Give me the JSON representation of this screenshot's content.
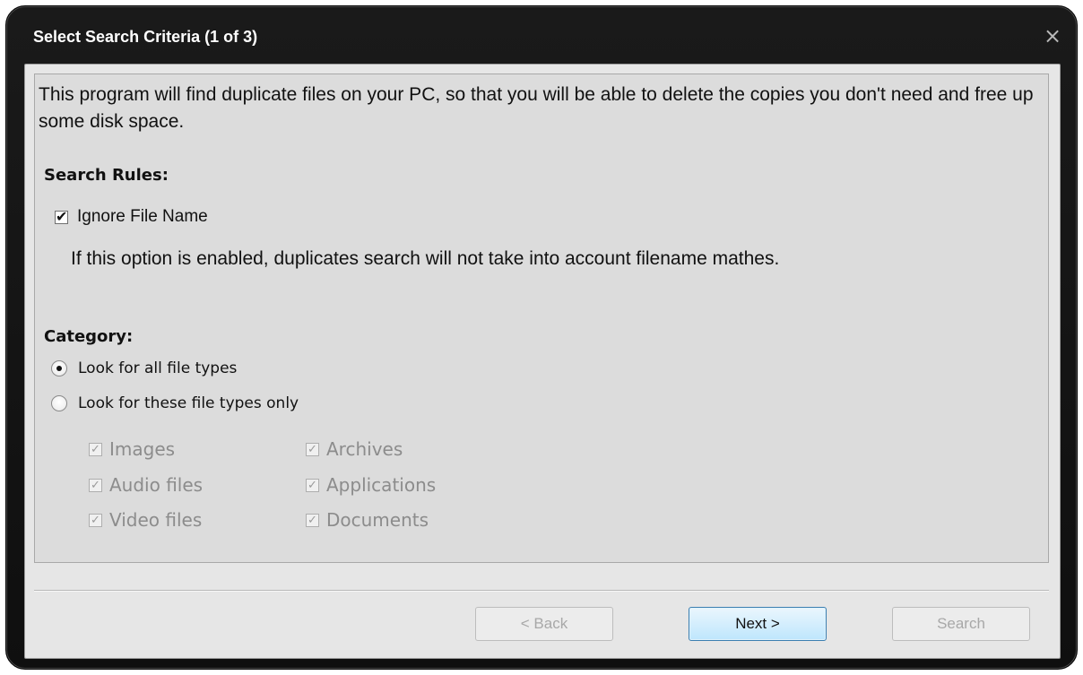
{
  "window": {
    "title": "Select Search Criteria (1 of 3)",
    "close_glyph": "×"
  },
  "intro_text": "This program will find duplicate files on your PC, so that you will be able to delete the copies you don't need and free up some disk space.",
  "search_rules": {
    "heading": "Search Rules:",
    "ignore_file_name": {
      "label": "Ignore File Name",
      "checked": true,
      "check_glyph": "✔"
    },
    "description": "If this option is enabled, duplicates search will not take into account filename mathes."
  },
  "category": {
    "heading": "Category:",
    "options": [
      {
        "label": "Look for all file types",
        "selected": true
      },
      {
        "label": "Look for these file types only",
        "selected": false
      }
    ],
    "file_types": [
      {
        "label": "Images",
        "checked": true
      },
      {
        "label": "Audio files",
        "checked": true
      },
      {
        "label": "Video files",
        "checked": true
      },
      {
        "label": "Archives",
        "checked": true
      },
      {
        "label": "Applications",
        "checked": true
      },
      {
        "label": "Documents",
        "checked": true
      }
    ],
    "file_type_check_glyph": "✓"
  },
  "buttons": {
    "back": {
      "label": "< Back",
      "enabled": false
    },
    "next": {
      "label": "Next >",
      "enabled": true
    },
    "search": {
      "label": "Search",
      "enabled": false
    }
  },
  "colors": {
    "title_bar": "#111111",
    "client_bg": "#e6e6e6",
    "disabled_text": "#8c8c8c",
    "primary_button_border": "#3c7fb1"
  }
}
